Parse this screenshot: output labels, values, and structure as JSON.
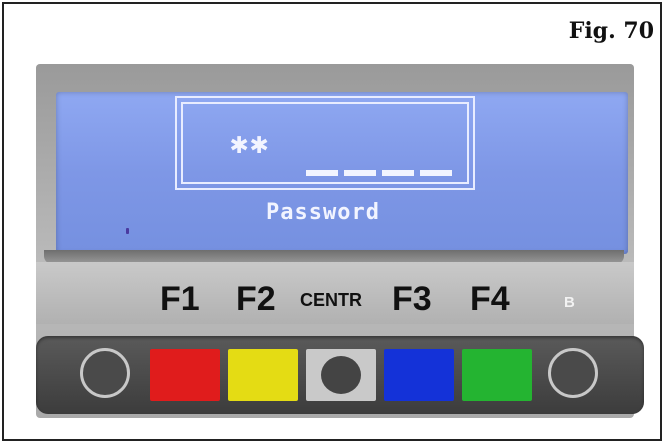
{
  "figure": {
    "label": "Fig. 70"
  },
  "lcd": {
    "masked_entry": "✱✱",
    "prompt": "Password"
  },
  "function_keys": [
    {
      "label": "F1"
    },
    {
      "label": "F2"
    },
    {
      "label": "CENTR"
    },
    {
      "label": "F3"
    },
    {
      "label": "F4"
    },
    {
      "label": "B"
    }
  ],
  "buttons": [
    {
      "name": "left-round",
      "color": "#4a4a4a"
    },
    {
      "name": "red",
      "color": "#e01c1c"
    },
    {
      "name": "yellow",
      "color": "#e4dc14"
    },
    {
      "name": "center-gray",
      "color": "#c9c9c9"
    },
    {
      "name": "blue",
      "color": "#1432d8"
    },
    {
      "name": "green",
      "color": "#24b431"
    },
    {
      "name": "right-round",
      "color": "#4a4a4a"
    }
  ]
}
